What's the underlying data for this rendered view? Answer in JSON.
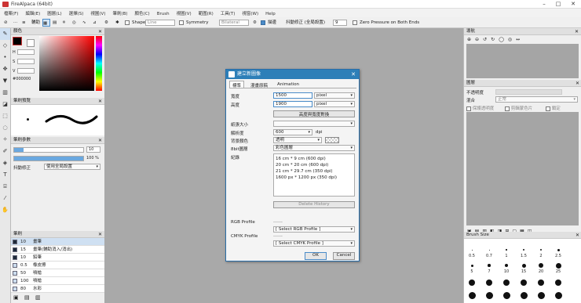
{
  "window": {
    "title": "FireAlpaca (64bit)",
    "minimize": "–",
    "maximize": "□",
    "close": "✕"
  },
  "menu": [
    "檔案(F)",
    "編輯(E)",
    "圖層(L)",
    "選擇(S)",
    "視圖(V)",
    "筆刷(B)",
    "顏色(C)",
    "Brush",
    "視圖(V)",
    "範圍(R)",
    "工具(T)",
    "視窗(W)",
    "Help"
  ],
  "toolbar": {
    "antialias": "輔助",
    "shape": "Shape",
    "shape_val": "Line",
    "symmetry": "Symmetry",
    "symmetry_val": "Bilateral",
    "icon_checked": "描邊",
    "stabilizer_label": "抖動修正 (全局設置)",
    "stabilizer_val": "9",
    "zero_pressure": "Zero Pressure on Both Ends"
  },
  "left": {
    "color_title": "顏色",
    "color_hex": "#000000",
    "hsv": {
      "h": "H",
      "s": "S",
      "v": "V"
    },
    "brush_preview_title": "筆刷預覽",
    "brush_control_title": "筆刷參數",
    "size_val": "10",
    "opacity_val": "100 %",
    "stab_label": "抖動修正",
    "stab_val": "使用全局設置",
    "brush_list_title": "筆刷",
    "brushes": [
      {
        "size": "10",
        "name": "畫筆"
      },
      {
        "size": "15",
        "name": "畫筆(輔助消入/消出)"
      },
      {
        "size": "10",
        "name": "鉛筆"
      },
      {
        "size": "0.5",
        "name": "橡皮擦"
      },
      {
        "size": "50",
        "name": "噴槍"
      },
      {
        "size": "100",
        "name": "噴槍"
      },
      {
        "size": "80",
        "name": "水彩"
      }
    ]
  },
  "right": {
    "navigator_title": "導航",
    "layer_title": "圖層",
    "opacity_label": "不透明度",
    "blend_label": "混合",
    "blend_val": "正常",
    "protect_alpha": "保護透明度",
    "clipping": "剪輯蒙色片",
    "lock": "鎖定",
    "brush_size_title": "Brush Size",
    "sizes_row1": [
      "0.5",
      "0.7",
      "1",
      "1.5",
      "2",
      "2.5"
    ],
    "sizes_row2": [
      "5",
      "7",
      "10",
      "15",
      "20",
      "25"
    ]
  },
  "dialog": {
    "title": "建立新圖像",
    "tabs": [
      "標準",
      "漫畫原稿",
      "Animation"
    ],
    "width_label": "寬度",
    "width_val": "1500",
    "height_label": "高度",
    "height_val": "1900",
    "unit": "pixel",
    "swap_btn": "高度與寬度對換",
    "paper_label": "紙張大小",
    "dpi_label": "解析度",
    "dpi_val": "600",
    "dpi_unit": "dpi",
    "bg_label": "背景顏色",
    "bg_val": "透明",
    "color_label": "8bit圖層",
    "color_val": "彩色圖層",
    "history_label": "紀錄",
    "history": [
      "16 cm * 9 cm (600 dpi)",
      "20 cm * 20 cm (600 dpi)",
      "21 cm * 29.7 cm (350 dpi)",
      "1600 px * 1200 px (350 dpi)"
    ],
    "delete_history": "Delete History",
    "rgb_label": "RGB Profile",
    "rgb_dash": "------",
    "rgb_val": "[ Select RGB Profile ]",
    "cmyk_label": "CMYK Profile",
    "cmyk_dash": "------",
    "cmyk_val": "[ Select CMYK Profile ]",
    "ok": "OK",
    "cancel": "Cancel"
  }
}
